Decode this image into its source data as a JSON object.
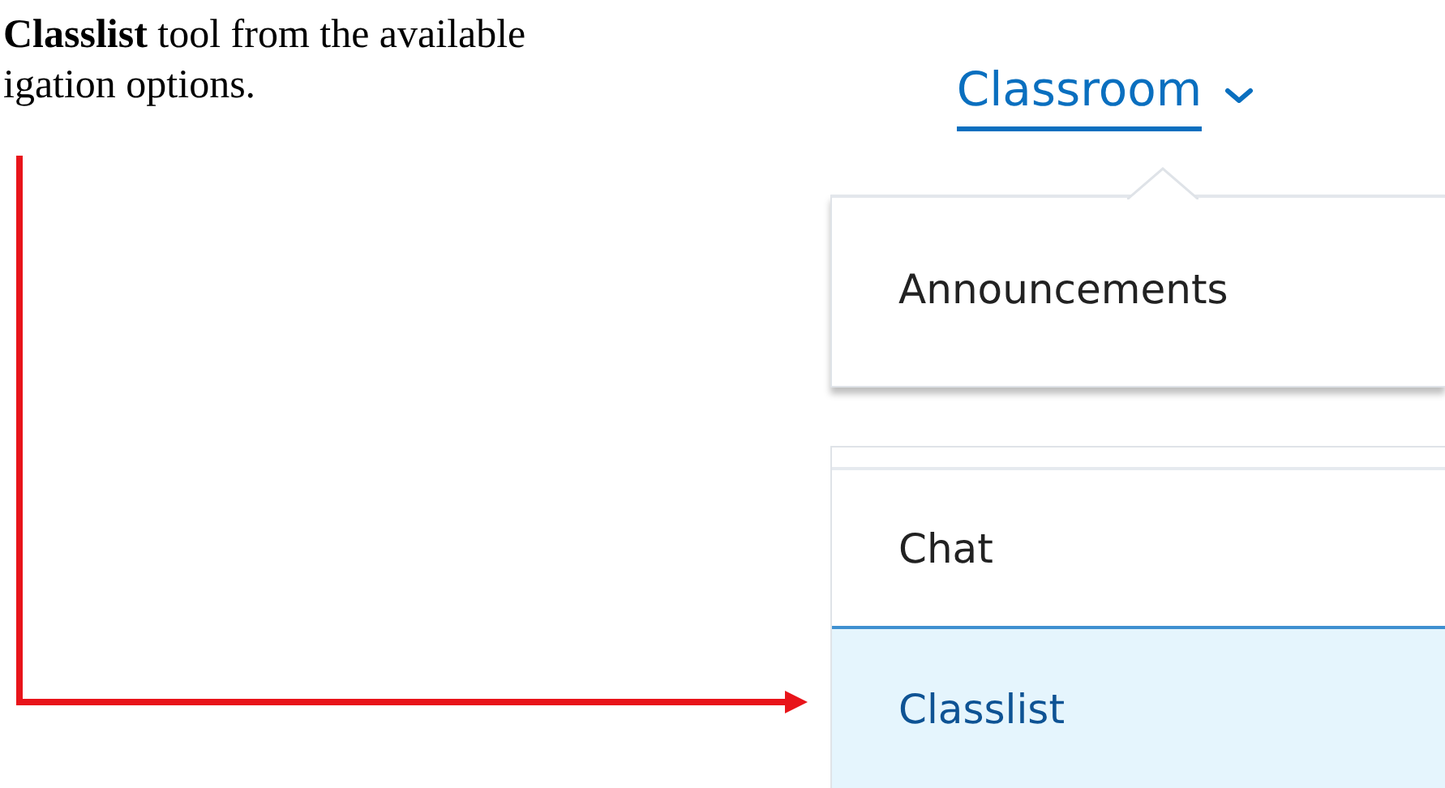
{
  "instruction": {
    "lines": [
      "**Classlist** tool from the available",
      "igation options."
    ]
  },
  "nav_menu": {
    "title": "Classroom",
    "groups": [
      {
        "items": [
          {
            "label": "Announcements",
            "selected": false
          }
        ]
      },
      {
        "items": [
          {
            "label": "Chat",
            "selected": false
          },
          {
            "label": "Classlist",
            "selected": true
          }
        ]
      }
    ]
  }
}
